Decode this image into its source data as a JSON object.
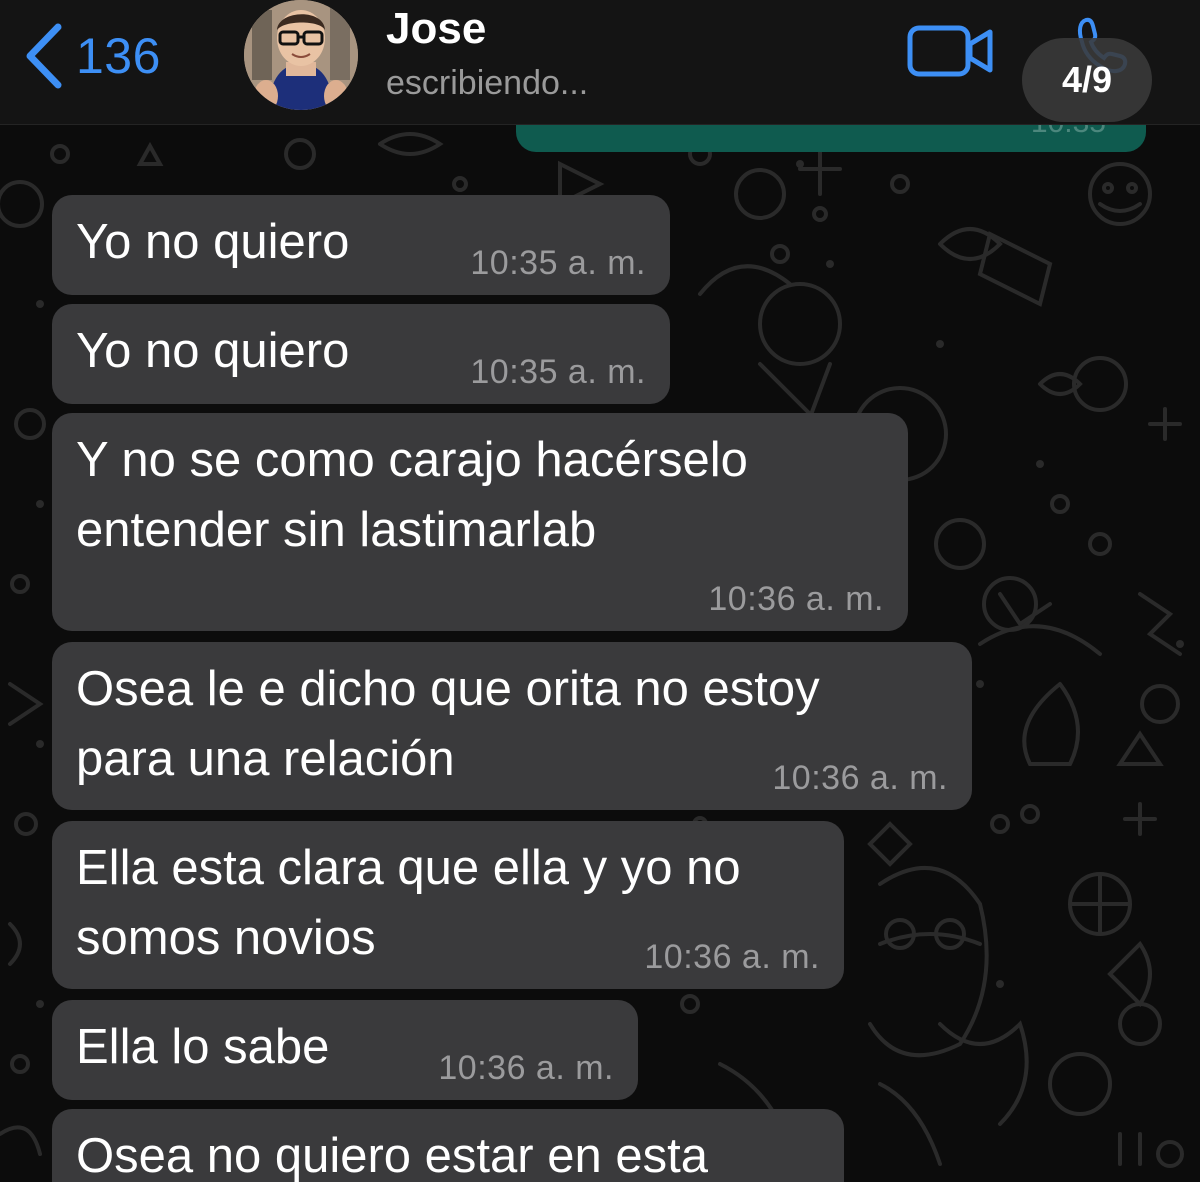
{
  "header": {
    "back_count": "136",
    "contact_name": "Jose",
    "contact_status": "escribiendo...",
    "pager": "4/9"
  },
  "colors": {
    "accent": "#3d8ff5",
    "incoming_bubble": "#3a3a3c",
    "outgoing_bubble": "#0f5b4f",
    "background": "#0b0b0b"
  },
  "icons": [
    "chevron-left-icon",
    "video-call-icon",
    "phone-icon"
  ],
  "messages": [
    {
      "text": "Yo no quiero",
      "time": "10:35 a. m."
    },
    {
      "text": "Yo no quiero",
      "time": "10:35 a. m."
    },
    {
      "text": "Y no se como carajo hacérselo\nentender sin lastimarlab",
      "time": "10:36 a. m."
    },
    {
      "text": "Osea le e dicho que orita no estoy\npara una relación",
      "time": "10:36 a. m."
    },
    {
      "text": "Ella esta clara que ella y yo no\nsomos novios",
      "time": "10:36 a. m."
    },
    {
      "text": "Ella lo sabe",
      "time": "10:36 a. m."
    },
    {
      "text": "Osea no quiero estar en esta",
      "time": ""
    }
  ]
}
